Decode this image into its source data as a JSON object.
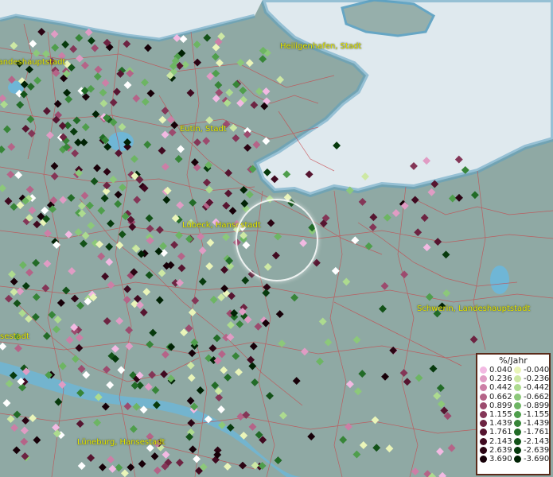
{
  "map": {
    "cities": [
      {
        "id": "landeshauptstadt-west",
        "label": "Landeshauptstadt"
      },
      {
        "id": "heiligenhafen",
        "label": "Heiligenhafen, Stadt"
      },
      {
        "id": "eutin",
        "label": "Eutin, Stadt"
      },
      {
        "id": "luebeck",
        "label": "Lübeck, Hansestadt"
      },
      {
        "id": "schwerin",
        "label": "Schwerin, Landeshauptstadt"
      },
      {
        "id": "hansestadt-west",
        "label": "sestadt"
      },
      {
        "id": "lueneburg",
        "label": "Lüneburg, Hansestadt"
      }
    ]
  },
  "legend": {
    "title": "%/Jahr",
    "positive": [
      {
        "label": "0.040",
        "color": "#f2b9e2"
      },
      {
        "label": "0.236",
        "color": "#e09cc4"
      },
      {
        "label": "0.442",
        "color": "#cc7fa6"
      },
      {
        "label": "0.662",
        "color": "#b56488"
      },
      {
        "label": "0.899",
        "color": "#9c4b6e"
      },
      {
        "label": "1.155",
        "color": "#843657"
      },
      {
        "label": "1.439",
        "color": "#6d2442"
      },
      {
        "label": "1.761",
        "color": "#561530"
      },
      {
        "label": "2.143",
        "color": "#400a20"
      },
      {
        "label": "2.639",
        "color": "#2b0413"
      },
      {
        "label": "3.690",
        "color": "#170008"
      }
    ],
    "negative": [
      {
        "label": "-0.040",
        "color": "#eaf5b9"
      },
      {
        "label": "-0.236",
        "color": "#cde8a4"
      },
      {
        "label": "-0.442",
        "color": "#addb8f"
      },
      {
        "label": "-0.662",
        "color": "#8cc87a"
      },
      {
        "label": "-0.899",
        "color": "#6db563"
      },
      {
        "label": "-1.155",
        "color": "#4f9e4c"
      },
      {
        "label": "-1.439",
        "color": "#378538"
      },
      {
        "label": "-1.761",
        "color": "#226b27"
      },
      {
        "label": "-2.143",
        "color": "#135218"
      },
      {
        "label": "-2.639",
        "color": "#073a0d"
      },
      {
        "label": "-3.690",
        "color": "#002204"
      }
    ]
  }
}
